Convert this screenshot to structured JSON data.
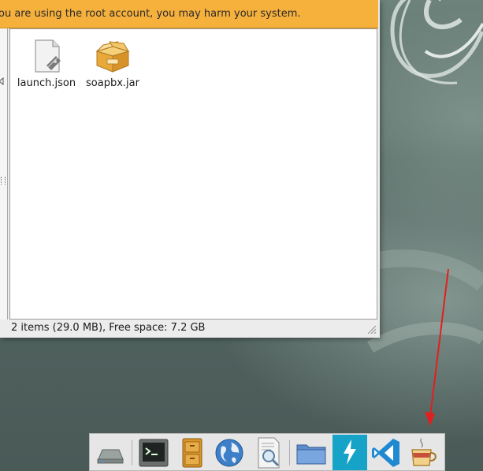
{
  "warning_bar": {
    "text": "ou are using the root account, you may harm your system."
  },
  "files": [
    {
      "name": "launch.json",
      "icon": "json-file-icon"
    },
    {
      "name": "soapbx.jar",
      "icon": "jar-package-icon"
    }
  ],
  "statusbar": {
    "text": "2 items (29.0 MB), Free space: 7.2 GB"
  },
  "dock": {
    "items": [
      {
        "name": "drive-icon"
      },
      {
        "name": "terminal-icon"
      },
      {
        "name": "file-cabinet-icon"
      },
      {
        "name": "web-browser-icon"
      },
      {
        "name": "document-viewer-icon"
      },
      {
        "name": "folder-icon"
      },
      {
        "name": "bolt-app-icon"
      },
      {
        "name": "vscode-icon"
      },
      {
        "name": "java-coffee-cup-icon"
      }
    ]
  },
  "colors": {
    "warning_bg": "#f6b03c",
    "desktop_bg": "#5a6d68",
    "annotation_arrow": "#e0201e",
    "bolt_tile": "#17a3c7",
    "vscode_blue": "#1f8ad2"
  }
}
